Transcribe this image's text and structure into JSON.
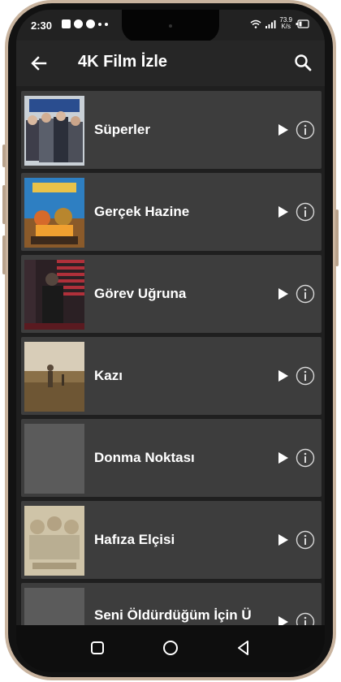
{
  "status_bar": {
    "time": "2:30",
    "net_speed_value": "73.9",
    "net_speed_unit": "K/s"
  },
  "app_bar": {
    "title": "4K Film İzle",
    "back_icon": "arrow-left-icon",
    "search_icon": "search-icon"
  },
  "movies": [
    {
      "title": "Süperler"
    },
    {
      "title": "Gerçek Hazine"
    },
    {
      "title": "Görev Uğruna"
    },
    {
      "title": "Kazı"
    },
    {
      "title": "Donma Noktası"
    },
    {
      "title": "Hafıza Elçisi"
    },
    {
      "title": "Seni Öldürdüğüm İçin Ü"
    }
  ],
  "row_icons": {
    "play": "play-icon",
    "info": "info-icon"
  },
  "nav_bar": {
    "recents": "recents-icon",
    "home": "home-icon",
    "back": "back-triangle-icon"
  },
  "colors": {
    "background": "#1f1f1f",
    "row": "#3d3d3d",
    "app_bar": "#262626",
    "text": "#ffffff",
    "frame": "#c9b49f"
  }
}
